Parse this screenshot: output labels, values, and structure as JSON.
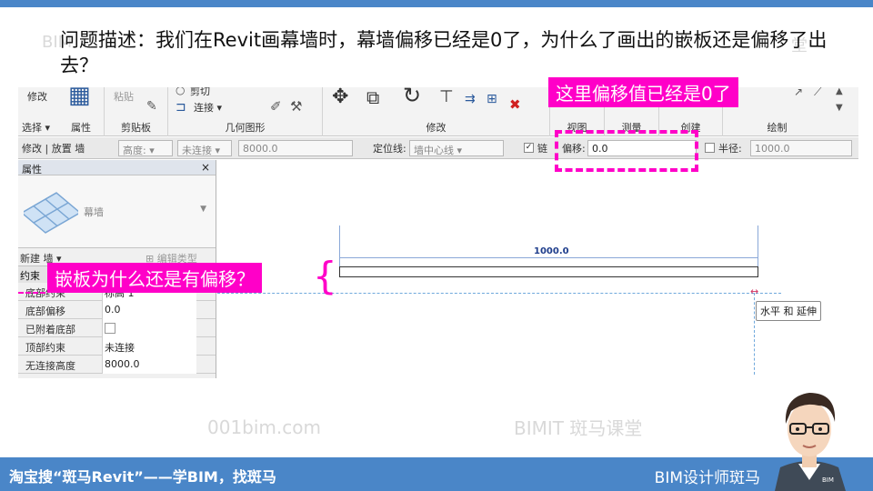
{
  "question": {
    "text": "问题描述：我们在Revit画幕墙时，幕墙偏移已经是0了，为什么了画出的嵌板还是偏移了出去？"
  },
  "watermarks": {
    "site": "001bim.com",
    "brand": "BIMIT 斑马课堂"
  },
  "ribbon": {
    "modify_label": "修改",
    "select_label": "选择 ▾",
    "properties_label": "属性",
    "paste_label": "粘贴",
    "clipboard_label": "剪贴板",
    "cut_label": "剪切",
    "join_label": "连接 ▾",
    "geometry_label": "几何图形",
    "modify_group_label": "修改",
    "view_label": "视图",
    "measure_label": "测量",
    "create_label": "创建",
    "draw_label": "绘制"
  },
  "options_bar": {
    "context": "修改 | 放置 墙",
    "height_label": "高度:",
    "unconnected": "未连接",
    "height_value": "8000.0",
    "location_line_label": "定位线:",
    "location_line_value": "墙中心线",
    "chain_label": "链",
    "chain_checked": true,
    "offset_label": "偏移:",
    "offset_value": "0.0",
    "radius_label": "半径:",
    "radius_checked": false,
    "radius_value": "1000.0"
  },
  "properties": {
    "title": "属性",
    "close": "×",
    "type_name": "幕墙",
    "new_label": "新建 墙",
    "edit_type_label": "编辑类型",
    "category": "约束",
    "rows": [
      {
        "key": "底部约束",
        "value": "标高 1"
      },
      {
        "key": "底部偏移",
        "value": "0.0"
      },
      {
        "key": "已附着底部",
        "value": ""
      },
      {
        "key": "顶部约束",
        "value": "未连接"
      },
      {
        "key": "无连接高度",
        "value": "8000.0"
      }
    ]
  },
  "canvas": {
    "dimension_value": "1000.0",
    "tooltip": "水平 和 延伸"
  },
  "callouts": {
    "offset_note": "这里偏移值已经是0了",
    "panel_note": "嵌板为什么还是有偏移？"
  },
  "footer": {
    "left_text": "淘宝搜“斑马Revit”——学BIM，找斑马",
    "right_text": "BIM设计师斑马"
  },
  "avatar": {
    "badge_text": "BIM"
  },
  "colors": {
    "accent_blue": "#4a86c8",
    "callout_magenta": "#ff00c8"
  }
}
